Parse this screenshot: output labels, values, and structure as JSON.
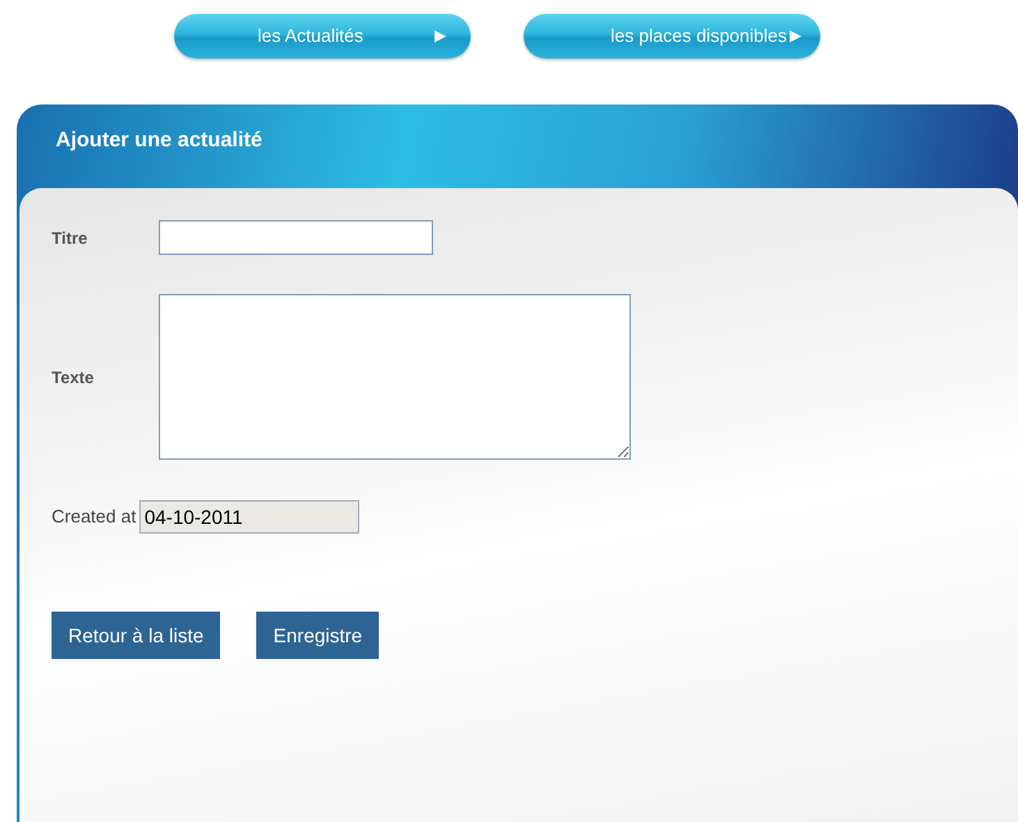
{
  "nav_buttons": [
    {
      "label": "les Actualités",
      "arrow": "▶"
    },
    {
      "label": "les places disponibles",
      "arrow": "▶"
    }
  ],
  "panel": {
    "title": "Ajouter une actualité"
  },
  "fields": [
    {
      "kind": "text",
      "label": "Titre"
    },
    {
      "kind": "textarea",
      "label": "Texte"
    },
    {
      "kind": "readonly",
      "label": "Created at",
      "value": "04-10-2011"
    }
  ],
  "buttons": [
    "Retour à la liste",
    "Enregistre"
  ]
}
